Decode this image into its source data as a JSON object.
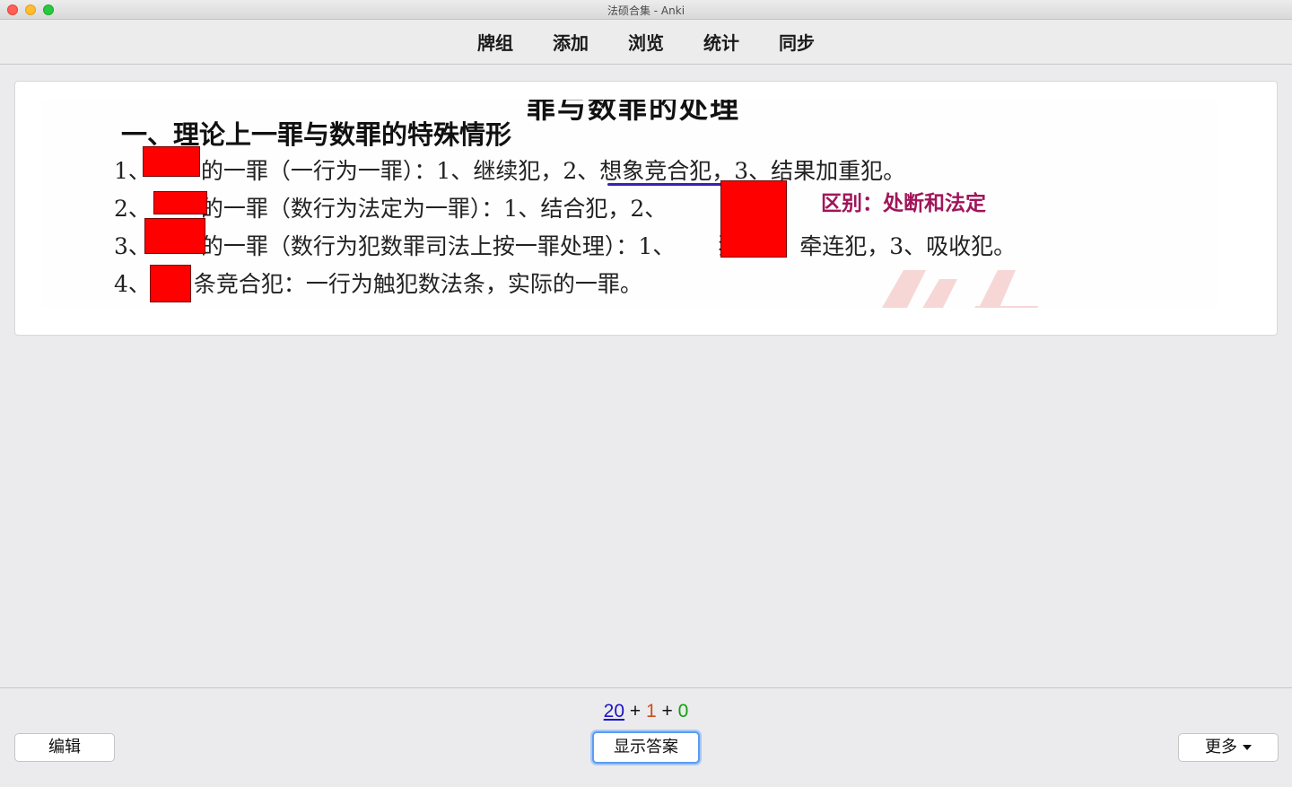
{
  "window": {
    "title": "法硕合集 - Anki"
  },
  "toolbar": {
    "items": [
      {
        "label": "牌组"
      },
      {
        "label": "添加"
      },
      {
        "label": "浏览"
      },
      {
        "label": "统计"
      },
      {
        "label": "同步"
      }
    ]
  },
  "card": {
    "cut_heading": "罪与数罪的处理",
    "heading": "一、理论上一罪与数罪的特殊情形",
    "lines": [
      {
        "prefix": "1、",
        "text": "的一罪（一行为一罪）：1、继续犯，",
        "underlined": "2、想象竞合犯",
        "rest": "，3、结果加重犯。"
      },
      {
        "prefix": "2、",
        "text": "的一罪（数行为法定为一罪）：1、结合犯，2、",
        "rest": "犯。"
      },
      {
        "prefix": "3、",
        "text": "的一罪（数行为犯数罪司法上按一罪处理）：1、",
        "rest": "犯，2、牵连犯，3、吸收犯。"
      },
      {
        "prefix": "4、",
        "text": "条竞合犯：一行为触犯数法条，实际的一罪。"
      }
    ],
    "note": "区别：处断和法定",
    "mask_color": "#ff0000"
  },
  "counts": {
    "new": "20",
    "learning": "1",
    "review": "0",
    "sep": "+"
  },
  "buttons": {
    "edit": "编辑",
    "show_answer": "显示答案",
    "more": "更多"
  }
}
